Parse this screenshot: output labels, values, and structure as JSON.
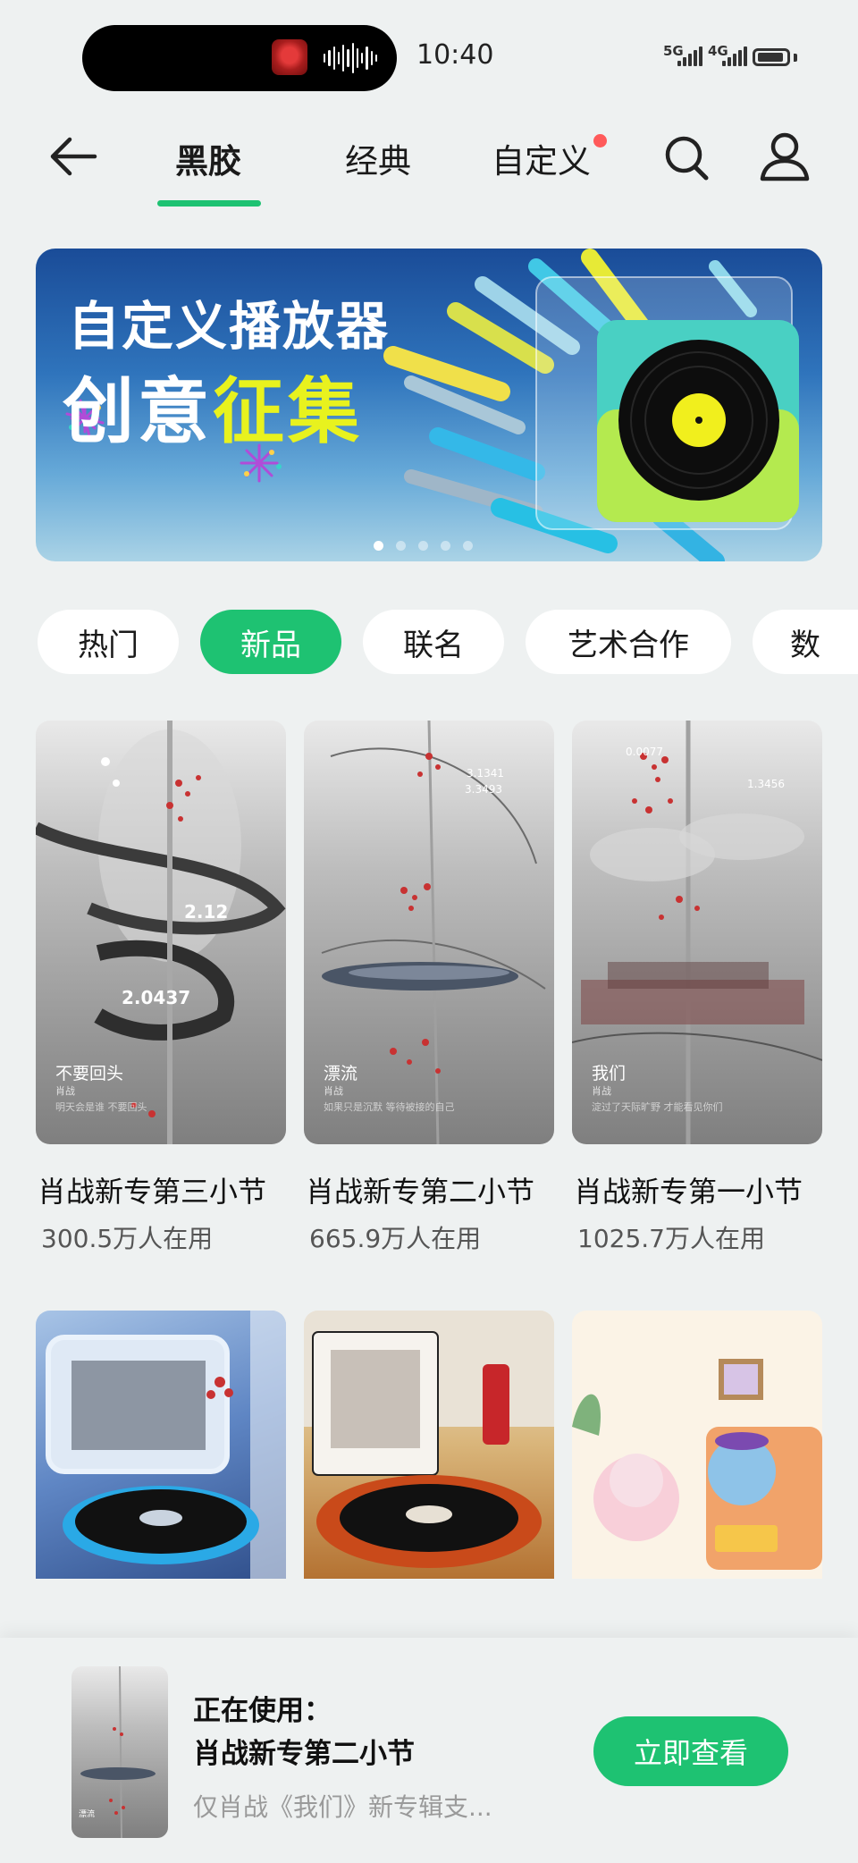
{
  "status_bar": {
    "time": "10:40",
    "signal_1": "5G",
    "signal_2": "4G",
    "icons": [
      "music-playing-thumbnail",
      "waveform-icon",
      "signal-icon",
      "battery-icon"
    ]
  },
  "nav": {
    "tabs": [
      {
        "label": "黑胶",
        "active": true
      },
      {
        "label": "经典",
        "active": false
      },
      {
        "label": "自定义",
        "active": false,
        "badge": true
      }
    ],
    "icons": [
      "back-arrow-icon",
      "search-icon",
      "profile-icon"
    ]
  },
  "banner": {
    "line1": "自定义播放器",
    "line2_a": "创意",
    "line2_b": "征集",
    "active_dot": 1,
    "dot_count": 5
  },
  "filters": [
    {
      "label": "热门",
      "active": false
    },
    {
      "label": "新品",
      "active": true
    },
    {
      "label": "联名",
      "active": false
    },
    {
      "label": "艺术合作",
      "active": false
    },
    {
      "label": "数",
      "active": false
    }
  ],
  "cards": [
    {
      "title": "肖战新专第三小节",
      "users": "300.5万人在用",
      "overlay_title": "不要回头",
      "overlay_sub": "肖战",
      "overlay_line": "明天会是谁 不要回头",
      "overlay_num": "2.0437",
      "overlay_num2": "2.12"
    },
    {
      "title": "肖战新专第二小节",
      "users": "665.9万人在用",
      "overlay_title": "漂流",
      "overlay_sub": "肖战",
      "overlay_line": "如果只是沉默 等待被接的自己",
      "overlay_num": "3.1341",
      "overlay_num2": "3.3493"
    },
    {
      "title": "肖战新专第一小节",
      "users": "1025.7万人在用",
      "overlay_title": "我们",
      "overlay_sub": "肖战",
      "overlay_line": "淀过了天际旷野 才能看见你们",
      "overlay_num": "0.0077",
      "overlay_num2": "1.3456"
    }
  ],
  "accent": "#1ec272",
  "now_using": {
    "label": "正在使用：",
    "name": "肖战新专第二小节",
    "desc": "仅肖战《我们》新专辑支...",
    "button": "立即查看",
    "thumb_title": "漂流"
  }
}
